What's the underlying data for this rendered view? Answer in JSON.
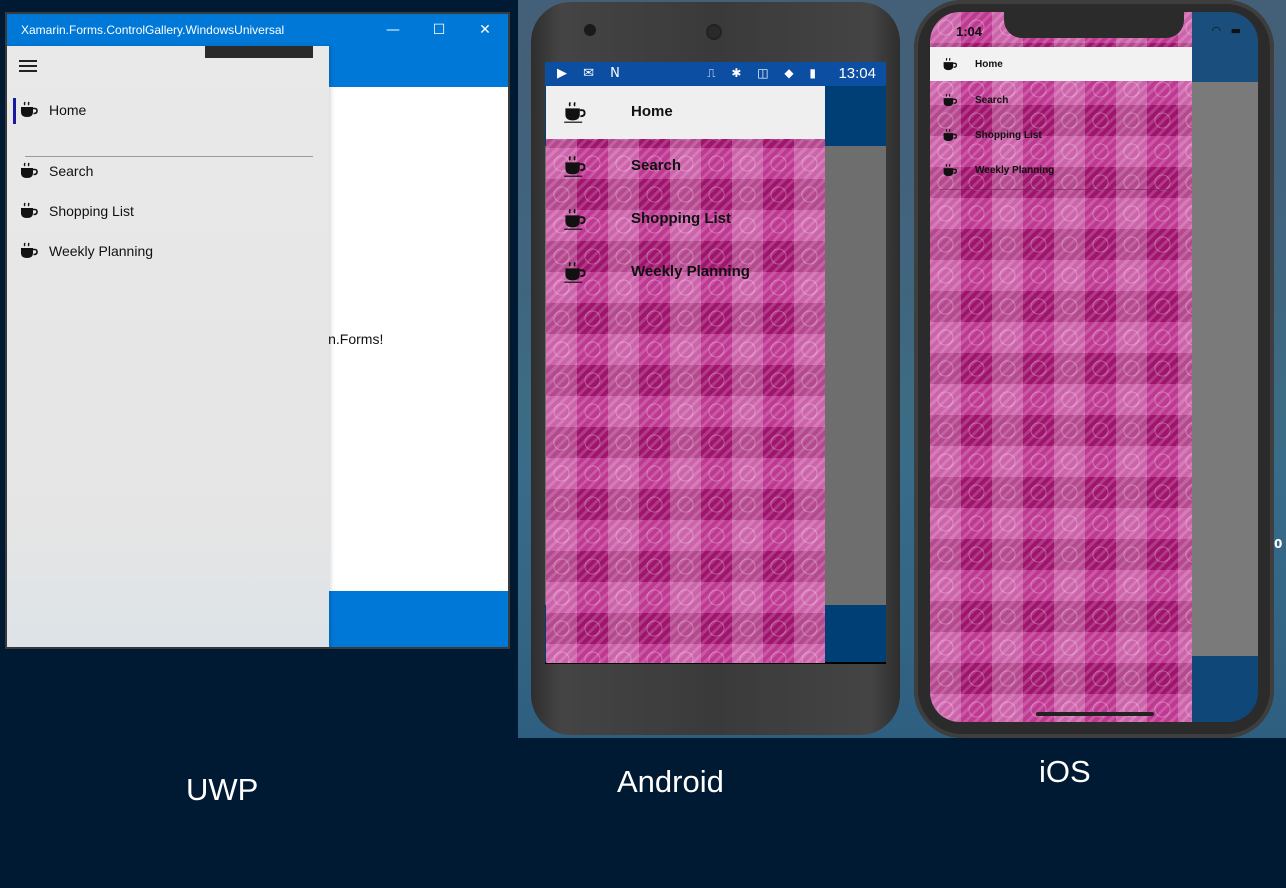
{
  "uwp": {
    "window_title": "Xamarin.Forms.ControlGallery.WindowsUniversal",
    "window_buttons": {
      "minimize": "—",
      "maximize": "☐",
      "close": "✕"
    },
    "content_text": "in.Forms!",
    "menu_items": [
      {
        "label": "Home",
        "icon": "coffee-cup-icon",
        "selected": true
      },
      {
        "label": "Search",
        "icon": "coffee-cup-icon",
        "selected": false
      },
      {
        "label": "Shopping List",
        "icon": "coffee-cup-icon",
        "selected": false
      },
      {
        "label": "Weekly Planning",
        "icon": "coffee-cup-icon",
        "selected": false
      }
    ],
    "platform_label": "UWP",
    "accent_color": "#0078d7"
  },
  "android": {
    "status_time": "13:04",
    "status_icons": [
      "youtube-icon",
      "gmail-icon",
      "n-icon",
      "cast-icon",
      "bluetooth-icon",
      "vibrate-icon",
      "wifi-icon",
      "battery-icon"
    ],
    "menu_items": [
      {
        "label": "Home",
        "icon": "coffee-cup-icon",
        "selected": true
      },
      {
        "label": "Search",
        "icon": "coffee-cup-icon",
        "selected": false
      },
      {
        "label": "Shopping List",
        "icon": "coffee-cup-icon",
        "selected": false
      },
      {
        "label": "Weekly Planning",
        "icon": "coffee-cup-icon",
        "selected": false
      }
    ],
    "platform_label": "Android",
    "status_bar_color": "#0b4ea2",
    "app_bar_color": "#003f75"
  },
  "ios": {
    "status_time": "1:04",
    "status_icons": [
      "wifi-icon",
      "battery-icon"
    ],
    "menu_items": [
      {
        "label": "Home",
        "icon": "coffee-cup-icon",
        "selected": true
      },
      {
        "label": "Search",
        "icon": "coffee-cup-icon",
        "selected": false
      },
      {
        "label": "Shopping List",
        "icon": "coffee-cup-icon",
        "selected": false
      },
      {
        "label": "Weekly Planning",
        "icon": "coffee-cup-icon",
        "selected": false
      }
    ],
    "platform_label": "iOS",
    "nav_color": "#1a4e7c"
  },
  "flyout_background_color": "#b61e84",
  "edge_text": "0"
}
